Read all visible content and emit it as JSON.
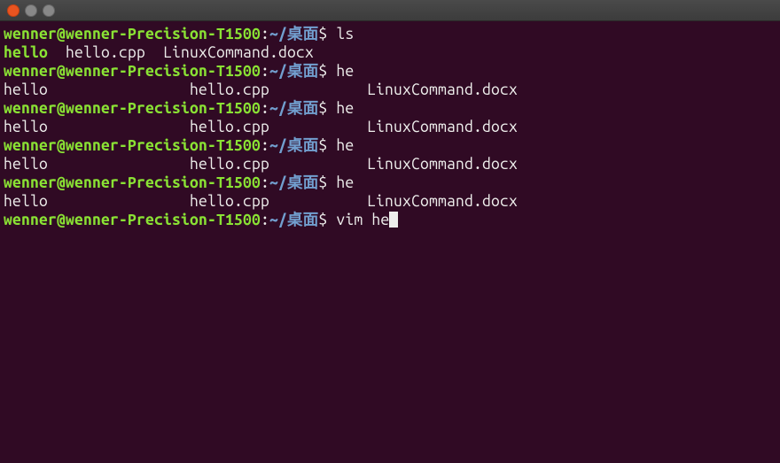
{
  "prompt": {
    "user_host": "wenner@wenner-Precision-T1500",
    "colon": ":",
    "path": "~/桌面",
    "dollar": "$ "
  },
  "lines": [
    {
      "type": "prompt",
      "cmd": "ls"
    },
    {
      "type": "ls_short",
      "items": [
        "hello",
        "hello.cpp",
        "LinuxCommand.docx"
      ]
    },
    {
      "type": "prompt",
      "cmd": "he"
    },
    {
      "type": "ls_cols",
      "items": [
        "hello",
        "hello.cpp",
        "LinuxCommand.docx"
      ]
    },
    {
      "type": "prompt",
      "cmd": "he"
    },
    {
      "type": "ls_cols",
      "items": [
        "hello",
        "hello.cpp",
        "LinuxCommand.docx"
      ]
    },
    {
      "type": "prompt",
      "cmd": "he"
    },
    {
      "type": "ls_cols",
      "items": [
        "hello",
        "hello.cpp",
        "LinuxCommand.docx"
      ]
    },
    {
      "type": "prompt",
      "cmd": "he"
    },
    {
      "type": "ls_cols",
      "items": [
        "hello",
        "hello.cpp",
        "LinuxCommand.docx"
      ]
    },
    {
      "type": "prompt_cursor",
      "cmd": "vim he"
    }
  ]
}
